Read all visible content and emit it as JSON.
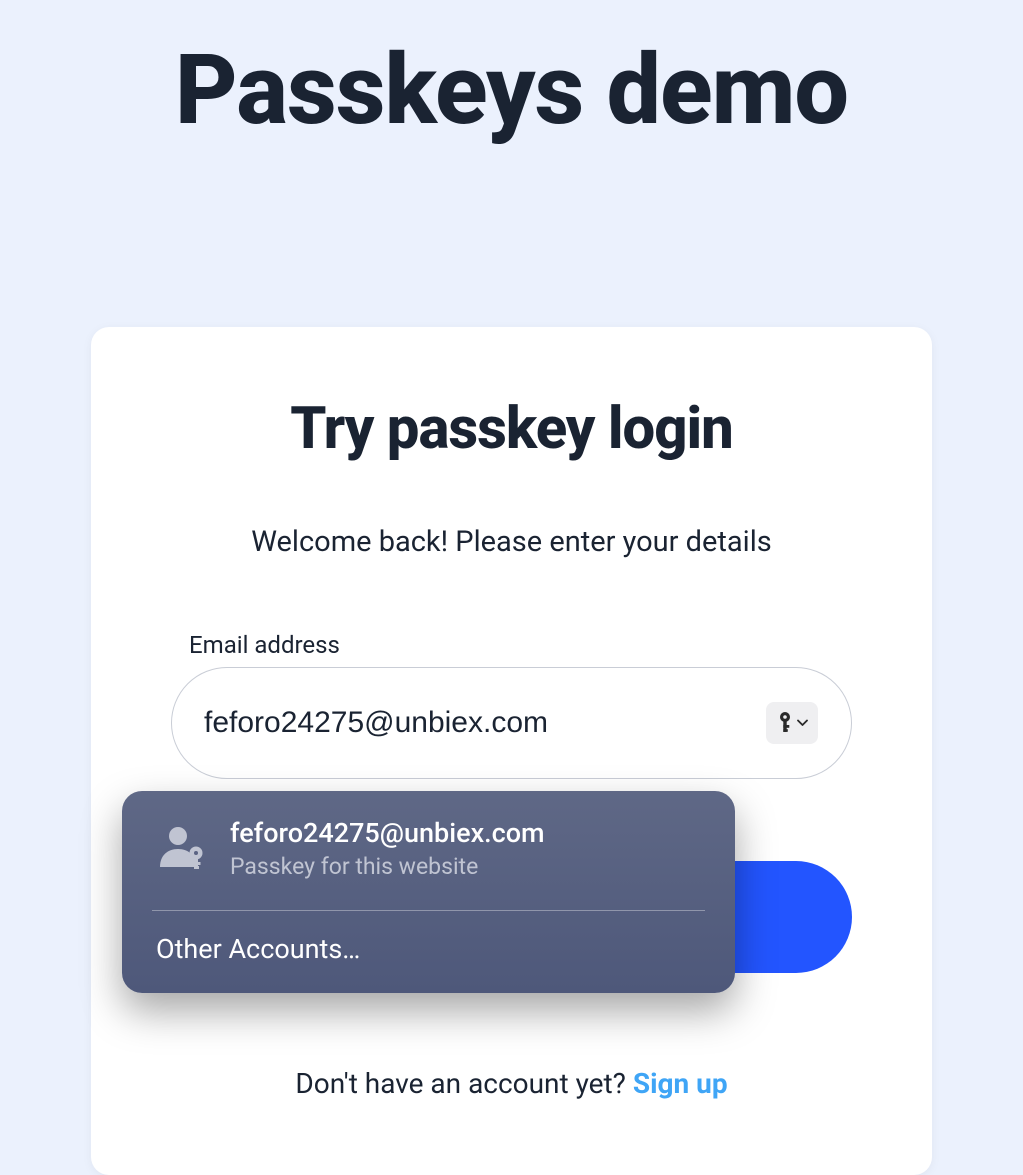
{
  "page": {
    "title": "Passkeys demo"
  },
  "card": {
    "title": "Try passkey login",
    "subtitle": "Welcome back! Please enter your details"
  },
  "form": {
    "email_label": "Email address",
    "email_value": "feforo24275@unbiex.com"
  },
  "signup": {
    "prompt": "Don't have an account yet? ",
    "link": "Sign up"
  },
  "autofill": {
    "entry": {
      "primary": "feforo24275@unbiex.com",
      "secondary": "Passkey for this website"
    },
    "other": "Other Accounts…"
  }
}
